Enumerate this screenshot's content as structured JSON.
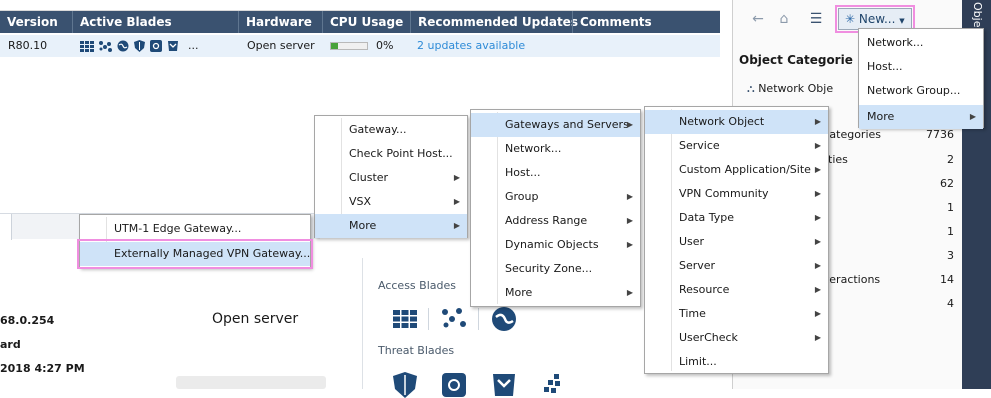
{
  "table": {
    "headers": [
      "Version",
      "Active Blades",
      "Hardware",
      "CPU Usage",
      "Recommended Updates",
      "Comments"
    ],
    "row": {
      "version": "R80.10",
      "blade_icons": [
        "grid-icon",
        "nodes-icon",
        "globe-icon",
        "shield-icon",
        "gear-blade-icon",
        "box-icon",
        "more-icon"
      ],
      "blades_more": "...",
      "hardware": "Open server",
      "cpu_percent": 0,
      "cpu_label": "0%",
      "updates": "2 updates available"
    }
  },
  "right_panel": {
    "toolbar_icons": [
      "back-arrow-icon",
      "home-icon",
      "list-icon"
    ],
    "new_button": "New...",
    "section_title": "Object Categorie",
    "first_item": "Network Obje",
    "rows": [
      {
        "label": "/Categories",
        "count": "7736"
      },
      {
        "label": "nities",
        "count": "2"
      },
      {
        "label": "",
        "count": "62"
      },
      {
        "label": "",
        "count": "1"
      },
      {
        "label": "",
        "count": "1"
      },
      {
        "label": "s",
        "count": "3"
      },
      {
        "label": "nteractions",
        "count": "14"
      },
      {
        "label": "",
        "count": "4"
      }
    ],
    "side_label": "Objects"
  },
  "new_menu": {
    "items": [
      "Network...",
      "Host...",
      "Network Group...",
      "More"
    ]
  },
  "menu_gateway": {
    "items": [
      "Gateway...",
      "Check Point Host...",
      "Cluster",
      "VSX",
      "More"
    ]
  },
  "menu_edge": {
    "items": [
      "UTM-1 Edge Gateway...",
      "Externally Managed VPN Gateway..."
    ]
  },
  "menu_servers": {
    "items": [
      "Gateways and Servers",
      "Network...",
      "Host...",
      "Group",
      "Address Range",
      "Dynamic Objects",
      "Security Zone...",
      "More"
    ]
  },
  "menu_object": {
    "items": [
      "Network Object",
      "Service",
      "Custom Application/Site",
      "VPN Community",
      "Data Type",
      "User",
      "Server",
      "Resource",
      "Time",
      "UserCheck",
      "Limit..."
    ]
  },
  "lower": {
    "ip": "68.0.254",
    "ard": "ard",
    "date": "2018 4:27 PM",
    "hardware": "Open server",
    "access_blades": "Access Blades",
    "threat_blades": "Threat Blades"
  },
  "colors": {
    "header_bg": "#3a5270",
    "row_highlight": "#e8f1fa",
    "menu_highlight": "#cfe3f8",
    "annotation_pink": "#f08ee0",
    "link": "#2e8bd7",
    "cpu_green": "#49a23a",
    "blade_navy": "#1f4a78"
  }
}
